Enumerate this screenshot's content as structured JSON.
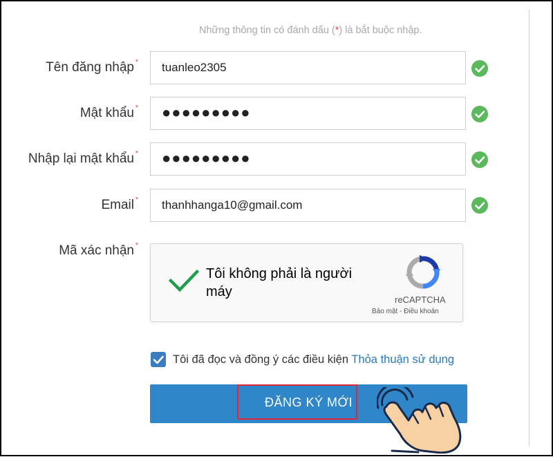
{
  "form": {
    "required_note_before": "Những thông tin có đánh dấu (",
    "required_note_star": "*",
    "required_note_after": ") là bắt buộc nhập.",
    "required_marker": "*",
    "fields": [
      {
        "label": "Tên đăng nhập",
        "value": "tuanleo2305"
      },
      {
        "label": "Mật khẩu",
        "value": "●●●●●●●●●"
      },
      {
        "label": "Nhập lại mật khẩu",
        "value": "●●●●●●●●●"
      },
      {
        "label": "Email",
        "value": "thanhhanga10@gmail.com"
      }
    ],
    "captcha_label": "Mã xác nhận"
  },
  "captcha": {
    "text": "Tôi không phải là người máy",
    "brand": "reCAPTCHA",
    "links": "Bảo mật - Điều khoản",
    "checked": true
  },
  "agreement": {
    "checked": true,
    "text": "Tôi đã đọc và đồng ý các điều kiện ",
    "link": "Thỏa thuận sử dụng"
  },
  "submit": {
    "label": "ĐĂNG KÝ MỚI"
  },
  "colors": {
    "success": "#5cb85c",
    "primary": "#2f86c9",
    "link": "#2a78b8",
    "required": "#e0534f",
    "highlight": "#e0263b"
  },
  "icons": [
    "check-circle-icon",
    "recaptcha-logo-icon",
    "checkmark-icon",
    "hand-pointer-icon"
  ]
}
